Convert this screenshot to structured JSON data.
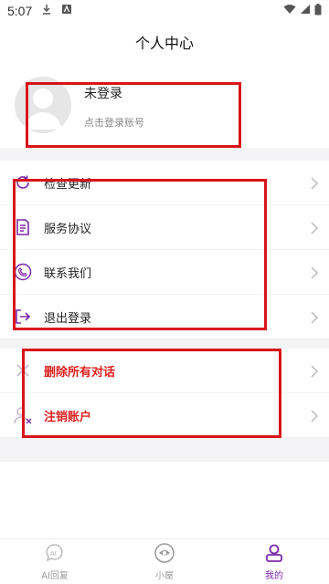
{
  "status_bar": {
    "time": "5:07"
  },
  "header": {
    "title": "个人中心"
  },
  "profile": {
    "name": "未登录",
    "subtitle": "点击登录账号"
  },
  "menu_group1": [
    {
      "label": "检查更新",
      "icon": "refresh-icon"
    },
    {
      "label": "服务协议",
      "icon": "document-icon"
    },
    {
      "label": "联系我们",
      "icon": "phone-icon"
    },
    {
      "label": "退出登录",
      "icon": "logout-icon"
    }
  ],
  "menu_group2": [
    {
      "label": "删除所有对话",
      "icon": "close-icon"
    },
    {
      "label": "注销账户",
      "icon": "user-remove-icon"
    }
  ],
  "tabbar": [
    {
      "label": "AI回复",
      "icon": "ai-icon",
      "active": false
    },
    {
      "label": "小屋",
      "icon": "house-icon",
      "active": false
    },
    {
      "label": "我的",
      "icon": "profile-icon",
      "active": true
    }
  ],
  "colors": {
    "accent": "#7b2aa8",
    "danger": "#e02020",
    "annotation": "#d8141a",
    "section_gap": "#f4f4f6"
  }
}
